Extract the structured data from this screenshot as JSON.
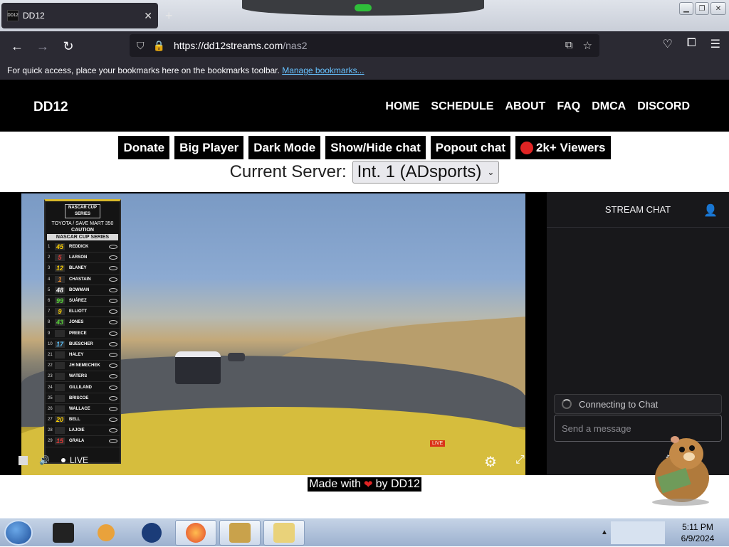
{
  "browser": {
    "tab_title": "DD12",
    "favicon_text": "DD12",
    "url_host": "https://dd12streams.com",
    "url_path": "/nas2",
    "bookmarks_text": "For quick access, place your bookmarks here on the bookmarks toolbar.",
    "bookmarks_link": "Manage bookmarks..."
  },
  "site": {
    "logo": "DD12",
    "nav": [
      "HOME",
      "SCHEDULE",
      "ABOUT",
      "FAQ",
      "DMCA",
      "DISCORD"
    ]
  },
  "controls": {
    "donate": "Donate",
    "big_player": "Big Player",
    "dark_mode": "Dark Mode",
    "show_hide_chat": "Show/Hide chat",
    "popout_chat": "Popout chat",
    "viewers": "2k+ Viewers"
  },
  "server": {
    "label": "Current Server:",
    "selected": "Int. 1 (ADsports)"
  },
  "leaderboard": {
    "logo": "NASCAR CUP SERIES",
    "event": "TOYOTA / SAVE MART 350",
    "flag": "CAUTION",
    "series": "NASCAR CUP SERIES",
    "rows": [
      {
        "pos": "1",
        "car": "45",
        "name": "REDDICK",
        "color": "#ffd200"
      },
      {
        "pos": "2",
        "car": "5",
        "name": "LARSON",
        "color": "#e53935"
      },
      {
        "pos": "3",
        "car": "12",
        "name": "BLANEY",
        "color": "#ffd200"
      },
      {
        "pos": "4",
        "car": "1",
        "name": "CHASTAIN",
        "color": "#f08c2b"
      },
      {
        "pos": "5",
        "car": "48",
        "name": "BOWMAN",
        "color": "#ffffff"
      },
      {
        "pos": "6",
        "car": "99",
        "name": "SUÁREZ",
        "color": "#59d23a"
      },
      {
        "pos": "7",
        "car": "9",
        "name": "ELLIOTT",
        "color": "#ffd200"
      },
      {
        "pos": "8",
        "car": "43",
        "name": "JONES",
        "color": "#59d23a"
      },
      {
        "pos": "9",
        "car": "",
        "name": "PREECE",
        "color": "#ffffff"
      },
      {
        "pos": "10",
        "car": "17",
        "name": "BUESCHER",
        "color": "#59c3ff"
      },
      {
        "pos": "21",
        "car": "",
        "name": "HALEY",
        "color": "#5a6cff"
      },
      {
        "pos": "22",
        "car": "",
        "name": "JH NEMECHEK",
        "color": "#f08c2b"
      },
      {
        "pos": "23",
        "car": "",
        "name": "WATERS",
        "color": "#ffffff"
      },
      {
        "pos": "24",
        "car": "",
        "name": "GILLILAND",
        "color": "#ffd200"
      },
      {
        "pos": "25",
        "car": "",
        "name": "BRISCOE",
        "color": "#5a6cff"
      },
      {
        "pos": "26",
        "car": "",
        "name": "WALLACE",
        "color": "#59c3ff"
      },
      {
        "pos": "27",
        "car": "20",
        "name": "BELL",
        "color": "#ffd200"
      },
      {
        "pos": "28",
        "car": "",
        "name": "LAJOIE",
        "color": "#ffd200"
      },
      {
        "pos": "29",
        "car": "15",
        "name": "GRALA",
        "color": "#e53935"
      }
    ]
  },
  "player": {
    "live_label": "LIVE",
    "channel_tag": "LIVE"
  },
  "chat": {
    "title": "STREAM CHAT",
    "connecting": "Connecting to Chat",
    "input_placeholder": "Send a message"
  },
  "footer": {
    "made_prefix": "Made with",
    "made_suffix": "by DD12"
  },
  "taskbar": {
    "time": "5:11 PM",
    "date": "6/9/2024"
  },
  "colors": {
    "browser_bg": "#2b2a33",
    "site_header": "#000000",
    "viewer_dot": "#e02424",
    "chat_bg": "#18181b"
  }
}
